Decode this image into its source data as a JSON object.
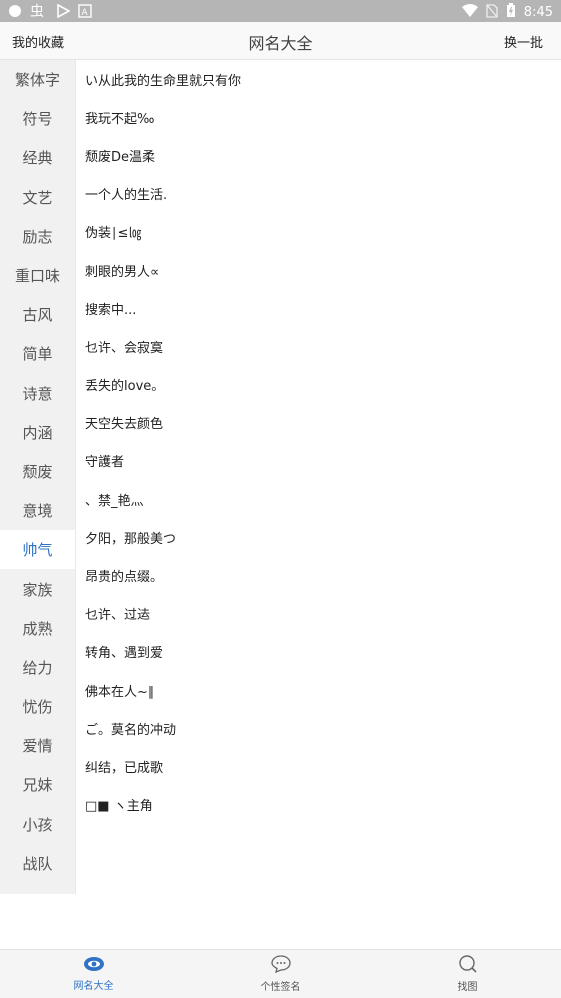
{
  "status_bar": {
    "time": "8:45",
    "icons": [
      "circle-icon",
      "bug-icon",
      "play-store-icon",
      "a-icon",
      "wifi-icon",
      "no-sim-icon",
      "battery-charging-icon"
    ]
  },
  "header": {
    "favorites_label": "我的收藏",
    "title": "网名大全",
    "refresh_label": "换一批"
  },
  "sidebar": {
    "categories": [
      "繁体字",
      "符号",
      "经典",
      "文艺",
      "励志",
      "重口味",
      "古风",
      "简单",
      "诗意",
      "内涵",
      "颓废",
      "意境",
      "帅气",
      "家族",
      "成熟",
      "给力",
      "忧伤",
      "爱情",
      "兄妹",
      "小孩",
      "战队"
    ],
    "active_index": 12
  },
  "names": [
    "い从此我的生命里就只有你",
    "我玩不起‰",
    "颓废De温柔",
    "一个人的生活.",
    "伪装∣≤㏒",
    "刺眼的男人∝",
    "搜索中...",
    "乜许、会寂寞",
    "丢失的love。",
    "天空失去颜色",
    "守護者",
    "、禁_艳灬",
    "夕阳，那般美つ",
    "昂贵的点缀。",
    "乜许、过迲",
    "转角、遇到爱",
    "佛本在人~∥",
    "ご。莫名的冲动",
    "纠结，已成歌",
    "□■ ヽ主角"
  ],
  "bottom_nav": {
    "tabs": [
      {
        "label": "网名大全",
        "icon": "eye-icon"
      },
      {
        "label": "个性签名",
        "icon": "chat-bubble-icon"
      },
      {
        "label": "找图",
        "icon": "search-icon"
      }
    ],
    "active_index": 0
  },
  "colors": {
    "accent": "#2e73c5",
    "status_bar": "#b5b5b5",
    "sidebar_bg": "#f1f1f1"
  }
}
